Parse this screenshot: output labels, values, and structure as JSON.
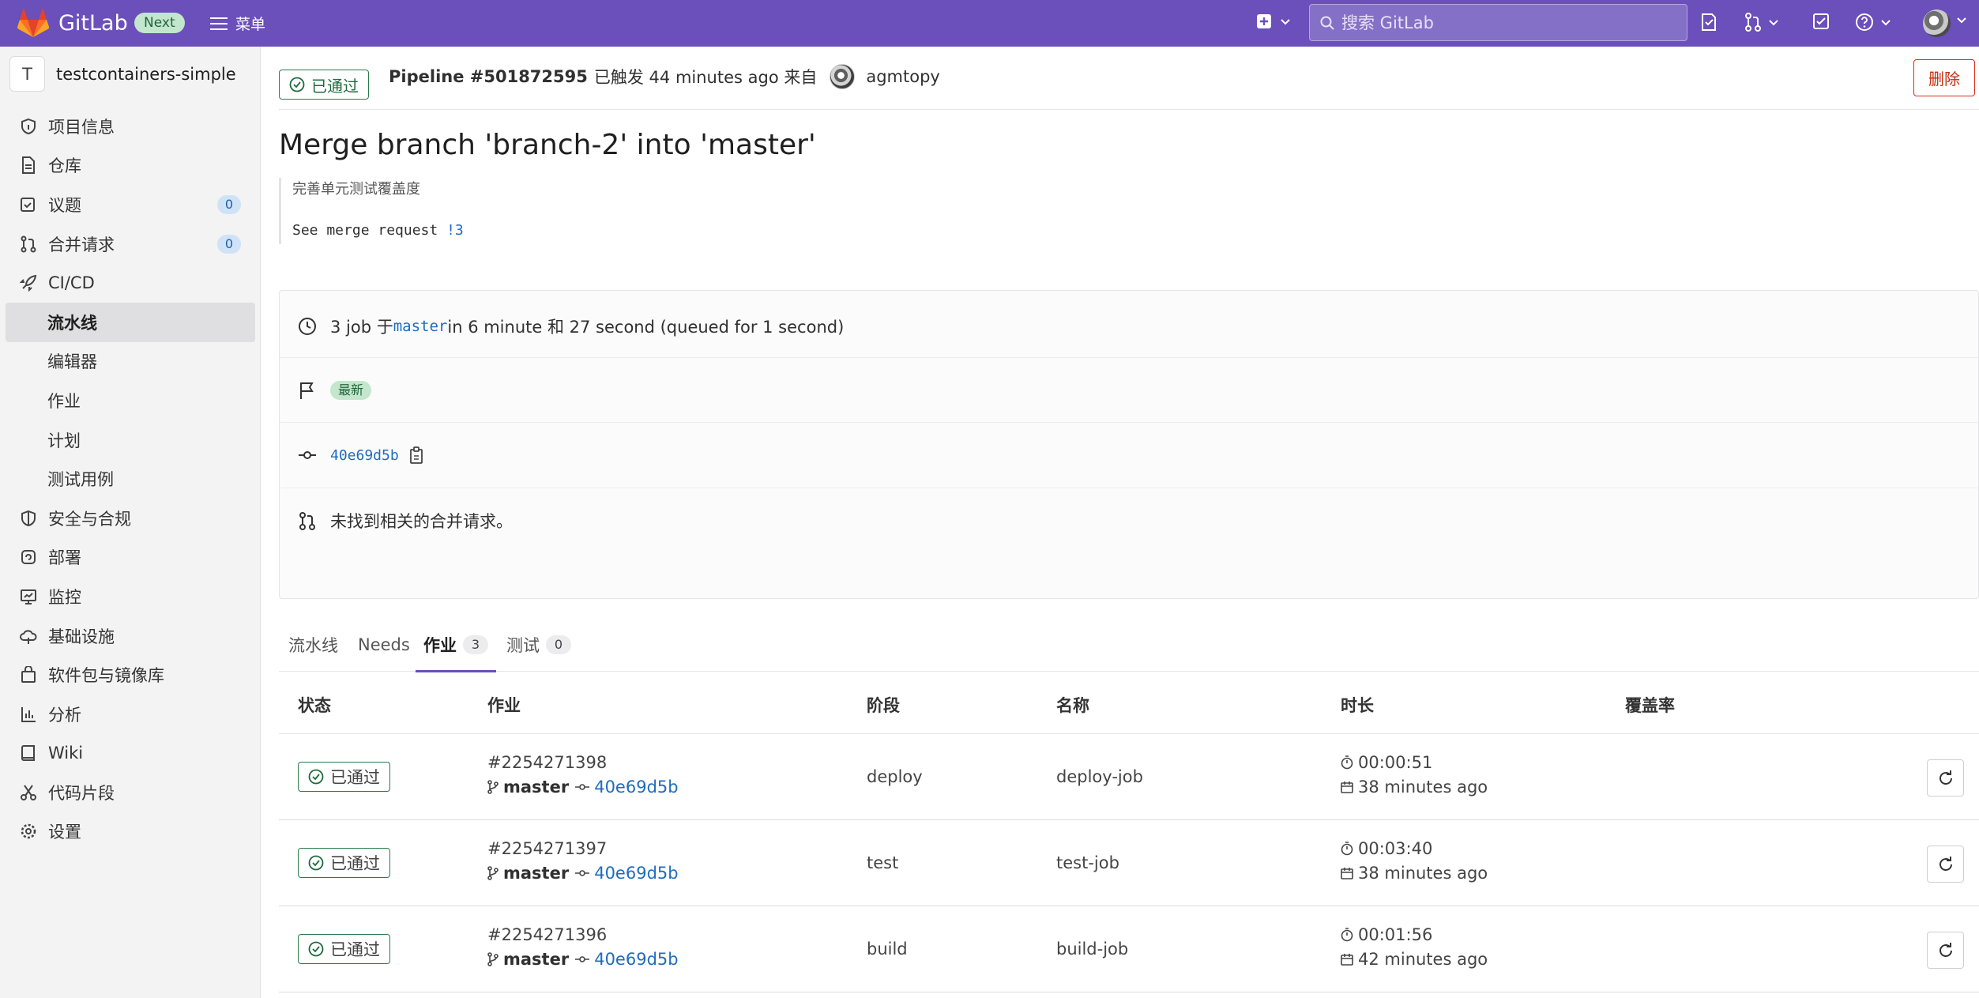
{
  "topbar": {
    "brand": "GitLab",
    "next_badge": "Next",
    "menu_label": "菜单",
    "search_placeholder": "搜索 GitLab"
  },
  "sidebar": {
    "project_initial": "T",
    "project_name": "testcontainers-simple",
    "items": [
      {
        "label": "项目信息",
        "icon": "info-icon"
      },
      {
        "label": "仓库",
        "icon": "document-icon"
      },
      {
        "label": "议题",
        "icon": "issues-icon",
        "count": "0"
      },
      {
        "label": "合并请求",
        "icon": "merge-request-icon",
        "count": "0"
      },
      {
        "label": "CI/CD",
        "icon": "rocket-icon"
      },
      {
        "label": "流水线",
        "sub": true,
        "active": true
      },
      {
        "label": "编辑器",
        "sub": true
      },
      {
        "label": "作业",
        "sub": true
      },
      {
        "label": "计划",
        "sub": true
      },
      {
        "label": "测试用例",
        "sub": true
      },
      {
        "label": "安全与合规",
        "icon": "shield-icon"
      },
      {
        "label": "部署",
        "icon": "deploy-icon"
      },
      {
        "label": "监控",
        "icon": "monitor-icon"
      },
      {
        "label": "基础设施",
        "icon": "cloud-icon"
      },
      {
        "label": "软件包与镜像库",
        "icon": "package-icon"
      },
      {
        "label": "分析",
        "icon": "chart-icon"
      },
      {
        "label": "Wiki",
        "icon": "book-icon"
      },
      {
        "label": "代码片段",
        "icon": "snippet-icon"
      },
      {
        "label": "设置",
        "icon": "gear-icon"
      }
    ]
  },
  "pipeline": {
    "status": "已通过",
    "title": "Pipeline #501872595",
    "triggered": "已触发 44 minutes ago 来自",
    "user": "agmtopy",
    "delete_label": "删除",
    "commit_title": "Merge branch 'branch-2' into 'master'",
    "desc_line1": "完善单元测试覆盖度",
    "desc_line2_prefix": "See merge request ",
    "desc_mr": "!3",
    "jobs_prefix": "3 job 于",
    "branch": "master",
    "jobs_suffix": " in 6 minute 和 27 second (queued for 1 second)",
    "latest_badge": "最新",
    "sha": "40e69d5b",
    "no_mr": "未找到相关的合并请求。"
  },
  "tabs": [
    {
      "label": "流水线"
    },
    {
      "label": "Needs"
    },
    {
      "label": "作业",
      "count": "3",
      "active": true
    },
    {
      "label": "测试",
      "count": "0"
    }
  ],
  "table": {
    "headers": [
      "状态",
      "作业",
      "阶段",
      "名称",
      "时长",
      "覆盖率"
    ],
    "rows": [
      {
        "status": "已通过",
        "id": "#2254271398",
        "branch": "master",
        "sha": "40e69d5b",
        "stage": "deploy",
        "name": "deploy-job",
        "duration": "00:00:51",
        "finished": "38 minutes ago"
      },
      {
        "status": "已通过",
        "id": "#2254271397",
        "branch": "master",
        "sha": "40e69d5b",
        "stage": "test",
        "name": "test-job",
        "duration": "00:03:40",
        "finished": "38 minutes ago"
      },
      {
        "status": "已通过",
        "id": "#2254271396",
        "branch": "master",
        "sha": "40e69d5b",
        "stage": "build",
        "name": "build-job",
        "duration": "00:01:56",
        "finished": "42 minutes ago"
      }
    ]
  },
  "colors": {
    "topbar": "#6b4fbb",
    "success": "#1d6b3d",
    "link": "#1f6cbf",
    "danger": "#c62a0c"
  }
}
